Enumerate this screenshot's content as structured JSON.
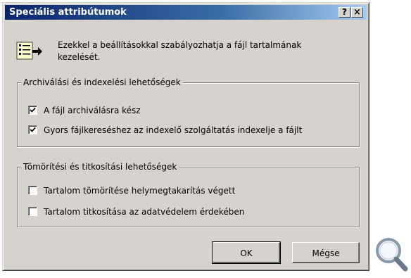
{
  "dialog": {
    "title": "Speciális attribútumok",
    "help_button": "?",
    "close_button": "×"
  },
  "intro": {
    "icon": "attributes-list-icon",
    "text": "Ezekkel a beállításokkal szabályozhatja a fájl tartalmának kezelését."
  },
  "archive_group": {
    "legend": "Archiválási és indexelési lehetőségek",
    "options": [
      {
        "label": "A fájl archiválásra kész",
        "checked": true
      },
      {
        "label": "Gyors fájlkereséshez az indexelő szolgáltatás indexelje a fájlt",
        "checked": true
      }
    ]
  },
  "compress_group": {
    "legend": "Tömörítési és titkosítási lehetőségek",
    "options": [
      {
        "label": "Tartalom tömörítése helymegtakarítás végett",
        "checked": false
      },
      {
        "label": "Tartalom titkosítása az adatvédelem érdekében",
        "checked": false
      }
    ]
  },
  "buttons": {
    "ok": "OK",
    "cancel": "Mégse"
  },
  "overlay": {
    "icon": "magnifier-icon"
  },
  "colors": {
    "title_gradient_start": "#0a246a",
    "title_gradient_end": "#a6caf0",
    "dialog_face": "#d6d3ce"
  }
}
